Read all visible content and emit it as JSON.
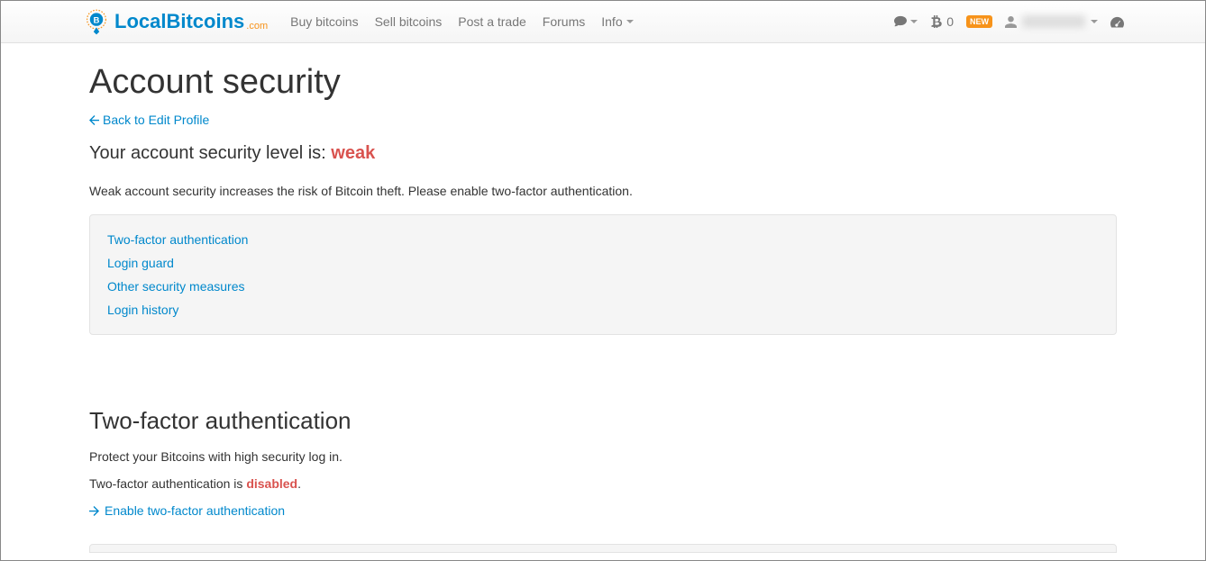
{
  "brand": {
    "name_part1": "Local",
    "name_part2": "Bitcoins",
    "tld": ".com"
  },
  "nav": {
    "buy": "Buy bitcoins",
    "sell": "Sell bitcoins",
    "post": "Post a trade",
    "forums": "Forums",
    "info": "Info"
  },
  "navRight": {
    "btc_count": "0",
    "new_badge": "NEW"
  },
  "page": {
    "title": "Account security",
    "back_link": "Back to Edit Profile",
    "level_label": "Your account security level is: ",
    "level_value": "weak",
    "warning": "Weak account security increases the risk of Bitcoin theft. Please enable two-factor authentication."
  },
  "toc": {
    "tfa": "Two-factor authentication",
    "login_guard": "Login guard",
    "other": "Other security measures",
    "history": "Login history"
  },
  "tfa": {
    "heading": "Two-factor authentication",
    "desc": "Protect your Bitcoins with high security log in.",
    "status_prefix": "Two-factor authentication is ",
    "status_value": "disabled",
    "status_suffix": ".",
    "enable_link": "Enable two-factor authentication"
  }
}
